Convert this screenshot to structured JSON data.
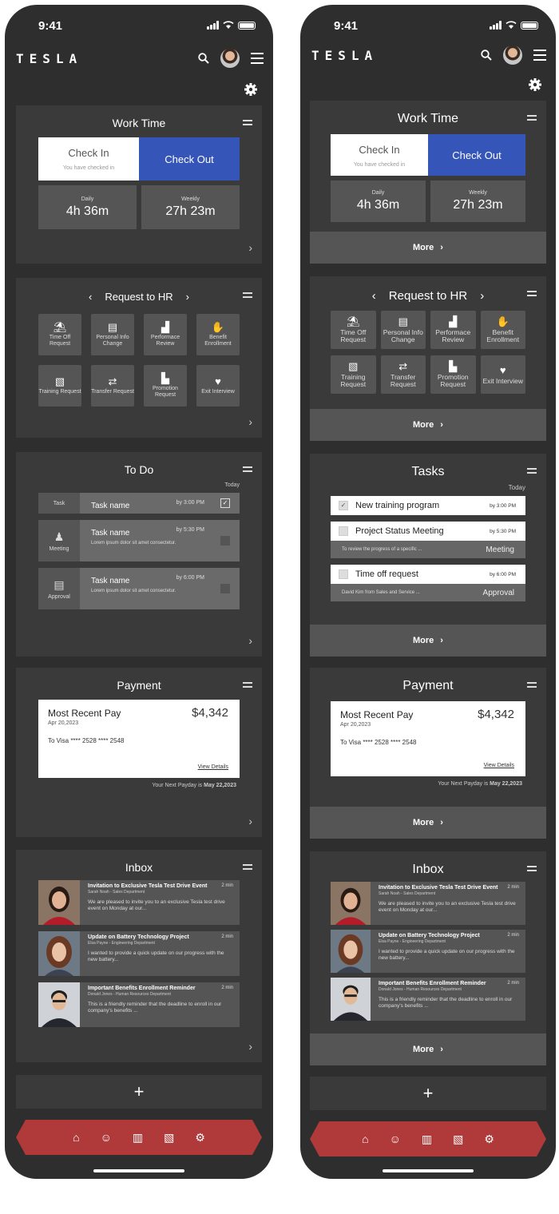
{
  "status": {
    "time": "9:41"
  },
  "header": {
    "logo": "TESLA"
  },
  "worktime": {
    "title": "Work Time",
    "check_in": "Check In",
    "check_in_sub": "You have checked in",
    "check_out": "Check Out",
    "daily_label": "Daily",
    "daily_value": "4h 36m",
    "weekly_label": "Weekly",
    "weekly_value": "27h 23m"
  },
  "more_label": "More",
  "hr": {
    "title": "Request to HR",
    "items": [
      {
        "label": "Time Off Request",
        "icon": "beach-umbrella-icon",
        "glyph": "⛱"
      },
      {
        "label": "Personal Info Change",
        "icon": "id-card-icon",
        "glyph": "▤"
      },
      {
        "label": "Performace Review",
        "icon": "bar-chart-icon",
        "glyph": "▟"
      },
      {
        "label": "Benefit Enrollment",
        "icon": "benefit-hand-icon",
        "glyph": "✋"
      },
      {
        "label": "Training Request",
        "icon": "training-board-icon",
        "glyph": "▧"
      },
      {
        "label": "Transfer Request",
        "icon": "swap-arrows-icon",
        "glyph": "⇄"
      },
      {
        "label": "Promotion Request",
        "icon": "stairs-up-icon",
        "glyph": "▙"
      },
      {
        "label": "Exit Interview",
        "icon": "heart-hands-icon",
        "glyph": "♥"
      }
    ]
  },
  "todo": {
    "title": "To Do",
    "today": "Today",
    "items": [
      {
        "type": "Task",
        "name": "Task name",
        "time": "by 3:00 PM",
        "desc": "",
        "checked": "✓"
      },
      {
        "type": "Meeting",
        "name": "Task name",
        "time": "by 5:30 PM",
        "desc": "Lorem ipsum dolor sit amet consectetur."
      },
      {
        "type": "Approval",
        "name": "Task name",
        "time": "by 6:00 PM",
        "desc": "Lorem ipsum dolor sit amet consectetur."
      }
    ]
  },
  "tasks": {
    "title": "Tasks",
    "today": "Today",
    "items": [
      {
        "name": "New training program",
        "time": "by 3:00 PM",
        "checked": "✓"
      },
      {
        "name": "Project Status Meeting",
        "time": "by 5:30 PM",
        "sub": "To review the progress of a specific ...",
        "tag": "Meeting"
      },
      {
        "name": "Time off request",
        "time": "by 6:00 PM",
        "sub": "David Kim from Sales and Service ...",
        "tag": "Approval"
      }
    ]
  },
  "payment": {
    "title": "Payment",
    "recent": "Most Recent Pay",
    "amount": "$4,342",
    "date": "Apr 20,2023",
    "to": "To  Visa **** 2528 **** 2548",
    "view": "View Details",
    "next_label": "Your Next Payday is ",
    "next_date": "May 22,2023"
  },
  "inbox": {
    "title": "Inbox",
    "items": [
      {
        "subject": "Invitation to Exclusive Tesla Test Drive Event",
        "from": "Sarah Noah - Sales Department",
        "age": "2 min",
        "body": "We are pleased to invite you to an exclusive Tesla test drive event on Monday at our..."
      },
      {
        "subject": "Update on Battery Technology Project",
        "from": "Elsa Payne - Engineering Department",
        "age": "2 min",
        "body": "I wanted to provide a quick update on our progress with the new battery..."
      },
      {
        "subject": "Important Benefits Enrollment Reminder",
        "from": "Donald Jones - Human Resources Department",
        "age": "2 min",
        "body": "This is a friendly reminder that the deadline to enroll in our company's benefits ..."
      }
    ]
  },
  "add": "+",
  "nav": {
    "icons": [
      "home-icon",
      "team-icon",
      "document-icon",
      "file-settings-icon",
      "gear-icon"
    ]
  }
}
